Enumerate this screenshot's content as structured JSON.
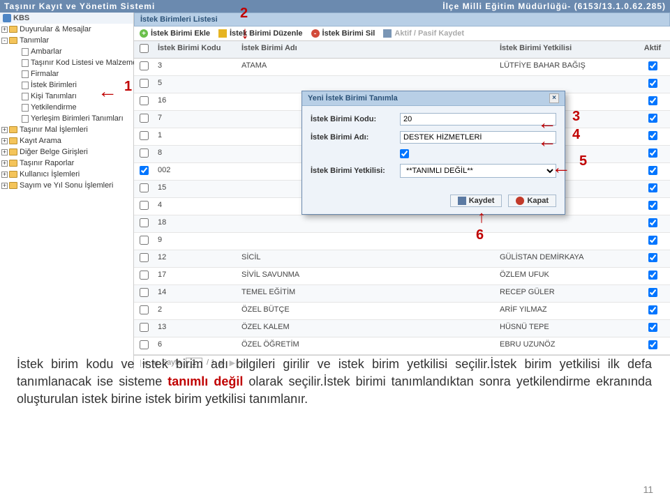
{
  "titlebar": {
    "left": "Taşınır Kayıt ve Yönetim Sistemi",
    "right": "İlçe Milli Eğitim Müdürlüğü- (6153/13.1.0.62.285)"
  },
  "sidebar": {
    "kbs": "KBS",
    "items": [
      {
        "lvl": 1,
        "exp": "+",
        "icon": "folder",
        "label": "Duyurular & Mesajlar"
      },
      {
        "lvl": 1,
        "exp": "-",
        "icon": "folder",
        "label": "Tanımlar"
      },
      {
        "lvl": 2,
        "exp": "",
        "icon": "doc",
        "label": "Ambarlar"
      },
      {
        "lvl": 2,
        "exp": "",
        "icon": "doc",
        "label": "Taşınır Kod Listesi ve Malzemeler"
      },
      {
        "lvl": 2,
        "exp": "",
        "icon": "doc",
        "label": "Firmalar"
      },
      {
        "lvl": 2,
        "exp": "",
        "icon": "doc",
        "label": "İstek Birimleri"
      },
      {
        "lvl": 2,
        "exp": "",
        "icon": "doc",
        "label": "Kişi Tanımları"
      },
      {
        "lvl": 2,
        "exp": "",
        "icon": "doc",
        "label": "Yetkilendirme"
      },
      {
        "lvl": 2,
        "exp": "",
        "icon": "doc",
        "label": "Yerleşim Birimleri Tanımları"
      },
      {
        "lvl": 1,
        "exp": "+",
        "icon": "folder",
        "label": "Taşınır Mal İşlemleri"
      },
      {
        "lvl": 1,
        "exp": "+",
        "icon": "folder",
        "label": "Kayıt Arama"
      },
      {
        "lvl": 1,
        "exp": "+",
        "icon": "folder",
        "label": "Diğer Belge Girişleri"
      },
      {
        "lvl": 1,
        "exp": "+",
        "icon": "folder",
        "label": "Taşınır Raporlar"
      },
      {
        "lvl": 1,
        "exp": "+",
        "icon": "folder",
        "label": "Kullanıcı İşlemleri"
      },
      {
        "lvl": 1,
        "exp": "+",
        "icon": "folder",
        "label": "Sayım ve Yıl Sonu İşlemleri"
      }
    ]
  },
  "panel": {
    "title": "İstek Birimleri Listesi",
    "toolbar": {
      "add": "İstek Birimi Ekle",
      "edit": "İstek Birimi Düzenle",
      "del": "İstek Birimi Sil",
      "save": "Aktif / Pasif Kaydet"
    },
    "headers": {
      "kod": "İstek Birimi Kodu",
      "adi": "İstek Birimi Adı",
      "yet": "İstek Birimi Yetkilisi",
      "akt": "Aktif"
    },
    "rows": [
      {
        "cb": false,
        "kod": "3",
        "adi": "ATAMA",
        "yet": "LÜTFİYE BAHAR BAĞIŞ",
        "akt": true
      },
      {
        "cb": false,
        "kod": "5",
        "adi": "",
        "yet": "",
        "akt": true
      },
      {
        "cb": false,
        "kod": "16",
        "adi": "",
        "yet": "",
        "akt": true
      },
      {
        "cb": false,
        "kod": "7",
        "adi": "",
        "yet": "",
        "akt": true
      },
      {
        "cb": false,
        "kod": "1",
        "adi": "",
        "yet": "",
        "akt": true
      },
      {
        "cb": false,
        "kod": "8",
        "adi": "",
        "yet": "",
        "akt": true
      },
      {
        "cb": true,
        "kod": "002",
        "adi": "",
        "yet": "",
        "akt": true
      },
      {
        "cb": false,
        "kod": "15",
        "adi": "",
        "yet": "",
        "akt": true
      },
      {
        "cb": false,
        "kod": "4",
        "adi": "",
        "yet": "",
        "akt": true
      },
      {
        "cb": false,
        "kod": "18",
        "adi": "",
        "yet": "",
        "akt": true
      },
      {
        "cb": false,
        "kod": "9",
        "adi": "",
        "yet": "",
        "akt": true
      },
      {
        "cb": false,
        "kod": "12",
        "adi": "SİCİL",
        "yet": "GÜLİSTAN DEMİRKAYA",
        "akt": true
      },
      {
        "cb": false,
        "kod": "17",
        "adi": "SİVİL SAVUNMA",
        "yet": "ÖZLEM UFUK",
        "akt": true
      },
      {
        "cb": false,
        "kod": "14",
        "adi": "TEMEL EĞİTİM",
        "yet": "RECEP GÜLER",
        "akt": true
      },
      {
        "cb": false,
        "kod": "2",
        "adi": "ÖZEL BÜTÇE",
        "yet": "ARİF YILMAZ",
        "akt": true
      },
      {
        "cb": false,
        "kod": "13",
        "adi": "ÖZEL KALEM",
        "yet": "HÜSNÜ TEPE",
        "akt": true
      },
      {
        "cb": false,
        "kod": "6",
        "adi": "ÖZEL ÖĞRETİM",
        "yet": "EBRU UZUNÖZ",
        "akt": true
      }
    ]
  },
  "pager": {
    "label": "Sayfa",
    "page": "1",
    "total": "/ 1"
  },
  "modal": {
    "title": "Yeni İstek Birimi Tanımla",
    "f1": {
      "label": "İstek Birimi Kodu:",
      "value": "20"
    },
    "f2": {
      "label": "İstek Birimi Adı:",
      "value": "DESTEK HİZMETLERİ"
    },
    "f3": {
      "label": ""
    },
    "f4": {
      "label": "İstek Birimi Yetkilisi:",
      "value": "**TANIMLI DEĞİL**"
    },
    "btn_save": "Kaydet",
    "btn_close": "Kapat"
  },
  "callouts": {
    "n1": "1",
    "n2": "2",
    "n3": "3",
    "n4": "4",
    "n5": "5",
    "n6": "6"
  },
  "explain": {
    "part1": "İstek birim kodu ve istek birim adı bilgileri girilir ve istek birim yetkilisi seçilir.İstek birim yetkilisi ilk defa tanımlanacak ise sisteme ",
    "red": "tanımlı değil",
    "part2": " olarak seçilir.İstek birimi tanımlandıktan sonra yetkilendirme ekranında oluşturulan istek birine istek birim yetkilisi tanımlanır."
  },
  "pagenum": "11"
}
